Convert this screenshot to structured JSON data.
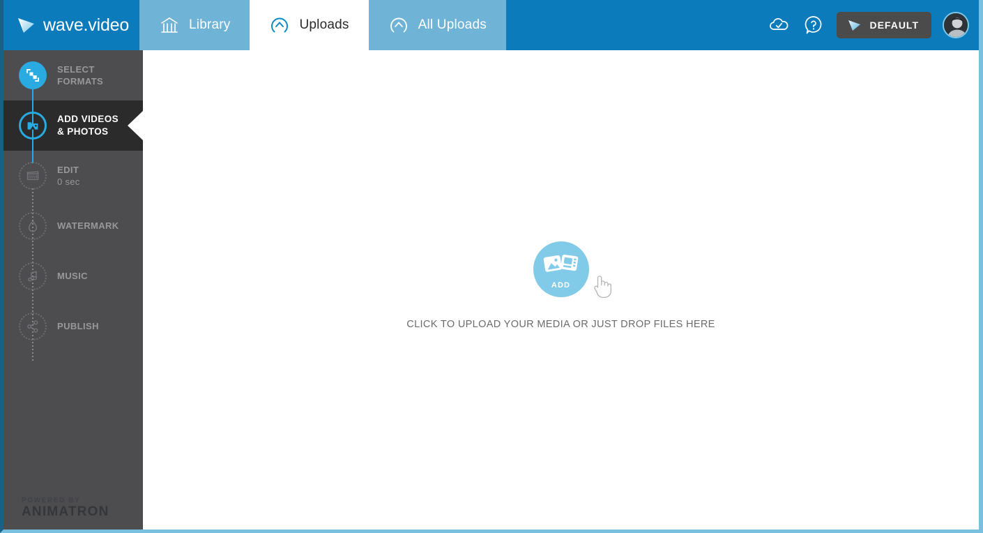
{
  "brand": {
    "name": "wave.video",
    "logo_icon": "wave-play-logo-icon",
    "accent_blue": "#0b7bbc",
    "accent_cyan": "#29aae1",
    "sidebar_gray": "#4d4d50",
    "active_dark": "#2b2b2b"
  },
  "header": {
    "tabs": [
      {
        "label": "Library",
        "icon": "library-building-icon",
        "active": false
      },
      {
        "label": "Uploads",
        "icon": "upload-arrow-circle-icon",
        "active": true
      },
      {
        "label": "All Uploads",
        "icon": "upload-arrow-circle-icon",
        "active": false
      }
    ],
    "icons": [
      {
        "name": "cloud-check-icon",
        "title": "Saved"
      },
      {
        "name": "help-question-icon",
        "title": "Help"
      }
    ],
    "project_button": {
      "label": "DEFAULT",
      "icon": "play-triangle-icon"
    },
    "avatar": {
      "name": "user-avatar",
      "icon": "avatar-photo-icon"
    }
  },
  "sidebar": {
    "steps": [
      {
        "label": "SELECT",
        "label2": "FORMATS",
        "sub": "",
        "state": "done",
        "icon": "crop-formats-icon"
      },
      {
        "label": "ADD VIDEOS",
        "label2": "& PHOTOS",
        "sub": "",
        "state": "current",
        "icon": "photo-media-icon"
      },
      {
        "label": "EDIT",
        "label2": "",
        "sub": "0 sec",
        "state": "todo",
        "icon": "clapperboard-icon"
      },
      {
        "label": "WATERMARK",
        "label2": "",
        "sub": "",
        "state": "todo",
        "icon": "water-droplet-icon"
      },
      {
        "label": "MUSIC",
        "label2": "",
        "sub": "",
        "state": "todo",
        "icon": "music-note-icon"
      },
      {
        "label": "PUBLISH",
        "label2": "",
        "sub": "",
        "state": "todo",
        "icon": "share-nodes-icon"
      }
    ],
    "footer": {
      "powered_by": "POWERED BY",
      "company": "ANIMATRON"
    }
  },
  "main": {
    "dropzone": {
      "add_label": "ADD",
      "hint": "CLICK TO UPLOAD YOUR MEDIA OR JUST DROP FILES HERE",
      "media_icon": "photo-and-film-icon",
      "cursor_icon": "pointing-hand-cursor-icon"
    }
  }
}
